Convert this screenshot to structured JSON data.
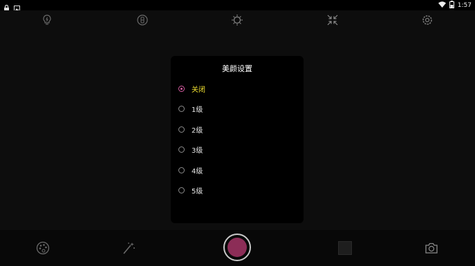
{
  "status_bar": {
    "time": "1:57"
  },
  "dialog": {
    "title": "美颜设置",
    "options": [
      {
        "label": "关闭",
        "selected": true
      },
      {
        "label": "1级",
        "selected": false
      },
      {
        "label": "2级",
        "selected": false
      },
      {
        "label": "3级",
        "selected": false
      },
      {
        "label": "4级",
        "selected": false
      },
      {
        "label": "5级",
        "selected": false
      }
    ]
  },
  "toolbar": {
    "icons": [
      "flash-icon",
      "hdr-icon",
      "white-balance-icon",
      "exposure-icon",
      "settings-gear-icon"
    ]
  },
  "bottom_bar": {
    "icons": [
      "filter-palette-icon",
      "beauty-wand-icon",
      "shutter-button",
      "gallery-thumbnail",
      "switch-camera-icon"
    ]
  },
  "colors": {
    "accent": "#d45aa0",
    "selected_text": "#f0e030",
    "shutter": "#8c2d57"
  }
}
